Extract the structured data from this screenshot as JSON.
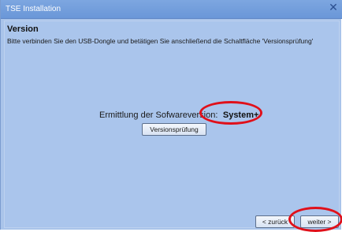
{
  "window": {
    "title": "TSE Installation",
    "close_icon": "close-icon"
  },
  "page": {
    "heading": "Version",
    "instruction": "Bitte verbinden Sie den USB-Dongle und betätigen Sie anschließend die Schaltfläche 'Versionsprüfung'"
  },
  "version": {
    "label": "Ermittlung der Sofwareversion:",
    "value": "System+"
  },
  "buttons": {
    "check_label": "Versionsprüfung",
    "back_label": "< zurück",
    "next_label": "weiter >"
  },
  "colors": {
    "highlight": "#e0101a",
    "panel_background": "#aac5ec",
    "titlebar": "#7da6e0"
  }
}
